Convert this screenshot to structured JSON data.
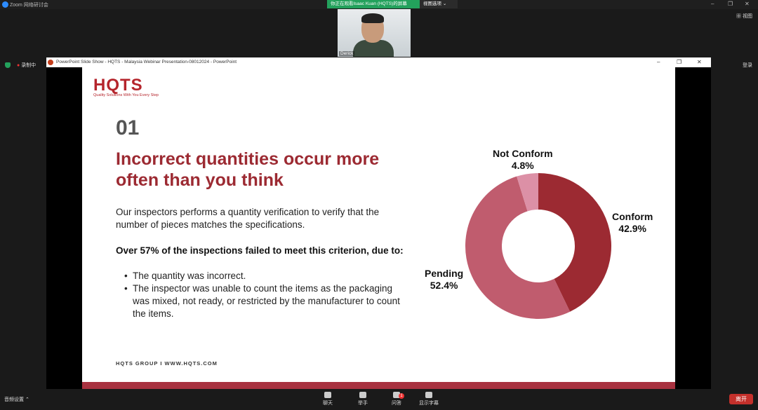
{
  "zoom": {
    "app_title": "Zoom 网络研讨会",
    "viewing_banner": "你正在观看Isaac Kuan (HQTS)的屏幕",
    "view_options": "视图选项",
    "view_label": "视图",
    "participant_name": "Derick",
    "recording_label": "录制中",
    "login_label": "登录",
    "audio_settings": "音频设置",
    "toolbar": {
      "chat": "聊天",
      "raise_hand": "举手",
      "qa": "问答",
      "qa_badge": "1",
      "captions": "显示字幕"
    },
    "leave": "离开"
  },
  "powerpoint": {
    "window_title": "PowerPoint Slide Show  -  HQTS - Malaysia Webinar Presentation-08012024 - PowerPoint"
  },
  "slide": {
    "logo_text": "HQTS",
    "logo_tagline": "Quality Solutions With You Every Step",
    "number": "01",
    "heading_line1": "Incorrect quantities occur more",
    "heading_line2": "often than you think",
    "paragraph": "Our inspectors performs a quantity verification to verify that the number of pieces matches the specifications.",
    "bold_statement": "Over 57% of the inspections failed to meet this criterion, due to:",
    "reasons": [
      "The quantity was incorrect.",
      "The inspector was unable to count the items as the packaging was mixed, not ready, or restricted by the manufacturer to count the items."
    ],
    "footer": "HQTS GROUP I WWW.HQTS.COM"
  },
  "chart_data": {
    "type": "pie",
    "categories": [
      "Conform",
      "Pending",
      "Not Conform"
    ],
    "values": [
      42.9,
      52.4,
      4.8
    ],
    "value_labels": [
      "42.9%",
      "52.4%",
      "4.8%"
    ],
    "colors": [
      "#9c2a32",
      "#c05c6e",
      "#dc90a6"
    ]
  }
}
